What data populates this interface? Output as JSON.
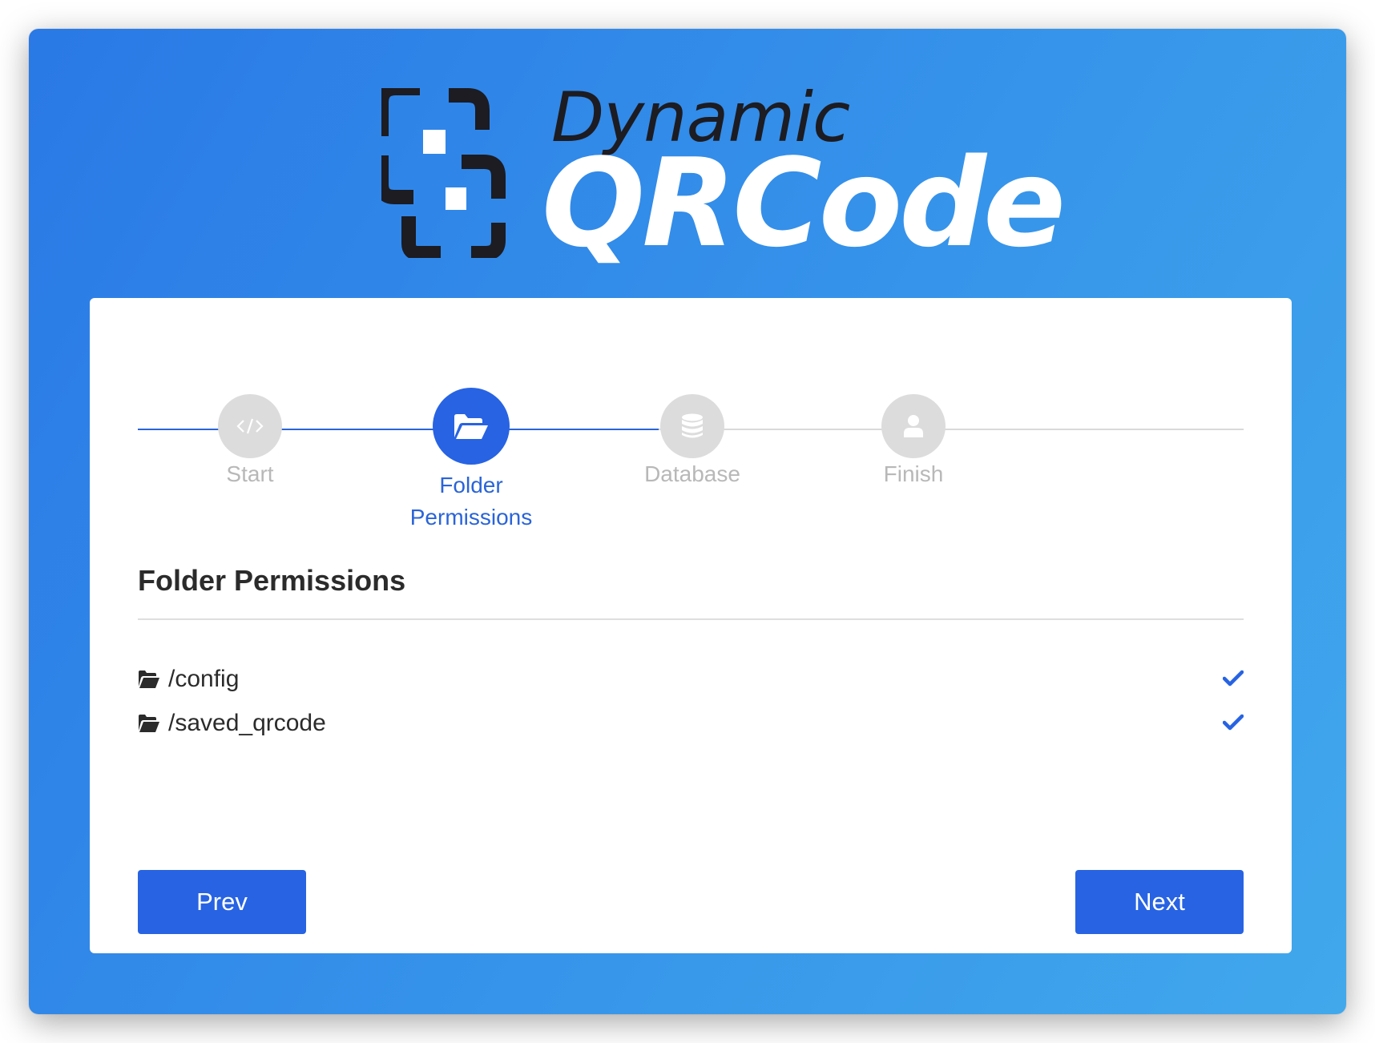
{
  "logo": {
    "word_top": "Dynamic",
    "word_bottom": "QRCode"
  },
  "colors": {
    "accent": "#2763e3",
    "background_gradient_start": "#2a79e6",
    "background_gradient_end": "#41a8ec",
    "inactive_step": "#dcdcdc",
    "inactive_label": "#b8b8b8"
  },
  "stepper": {
    "steps": [
      {
        "label": "Start",
        "icon": "code-icon",
        "state": "completed"
      },
      {
        "label": "Folder Permissions",
        "label_line1": "Folder",
        "label_line2": "Permissions",
        "icon": "folder-open-icon",
        "state": "active"
      },
      {
        "label": "Database",
        "icon": "database-icon",
        "state": "inactive"
      },
      {
        "label": "Finish",
        "icon": "user-icon",
        "state": "inactive"
      }
    ]
  },
  "section": {
    "title": "Folder Permissions"
  },
  "permissions": [
    {
      "path": "/config",
      "icon": "folder-open-icon",
      "status_icon": "check-icon"
    },
    {
      "path": "/saved_qrcode",
      "icon": "folder-open-icon",
      "status_icon": "check-icon"
    }
  ],
  "buttons": {
    "prev_label": "Prev",
    "next_label": "Next"
  }
}
